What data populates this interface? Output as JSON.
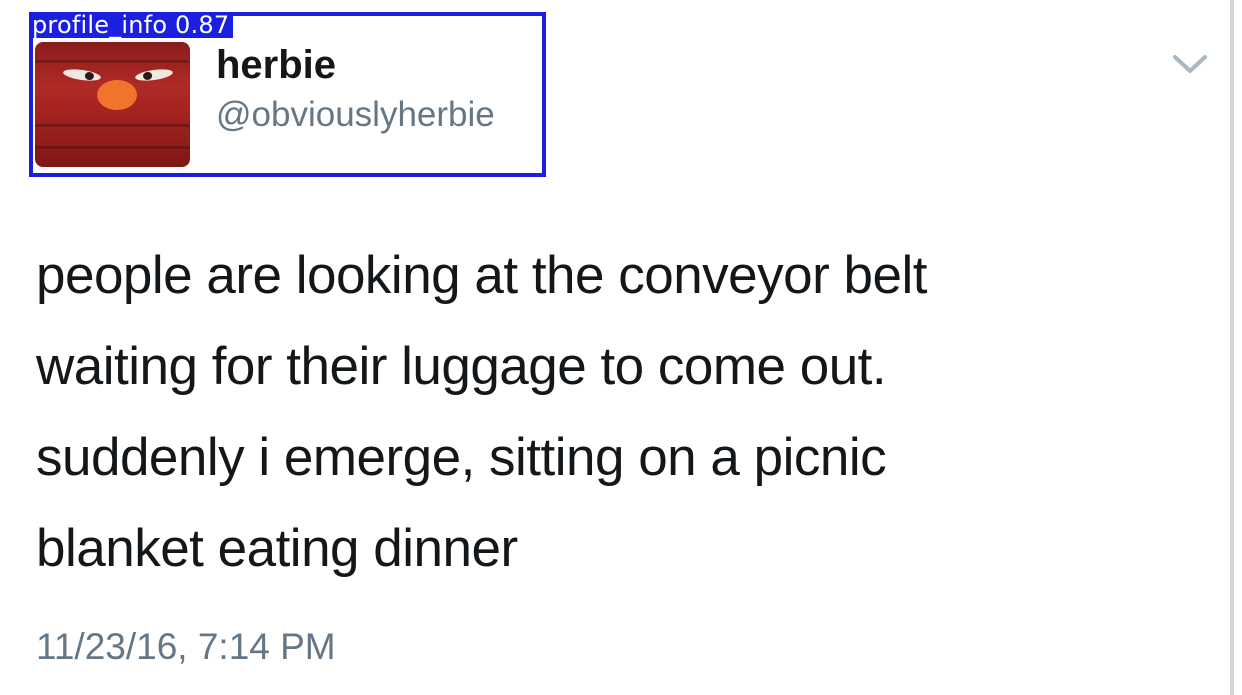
{
  "detection": {
    "label": "profile_info 0.87"
  },
  "profile": {
    "display_name": "herbie",
    "handle": "@obviouslyherbie",
    "avatar_icon": "red-puppet-avatar"
  },
  "tweet": {
    "lines": [
      "people are looking at the conveyor belt",
      "waiting for their luggage to come out.",
      "suddenly i emerge, sitting on a picnic",
      "blanket eating dinner"
    ],
    "timestamp": "11/23/16, 7:14 PM"
  },
  "menu": {
    "icon": "chevron-down-icon"
  },
  "colors": {
    "text_primary": "#14171a",
    "text_secondary": "#657786",
    "detection_box": "#1a1fe0",
    "chevron": "#aab8c2"
  }
}
